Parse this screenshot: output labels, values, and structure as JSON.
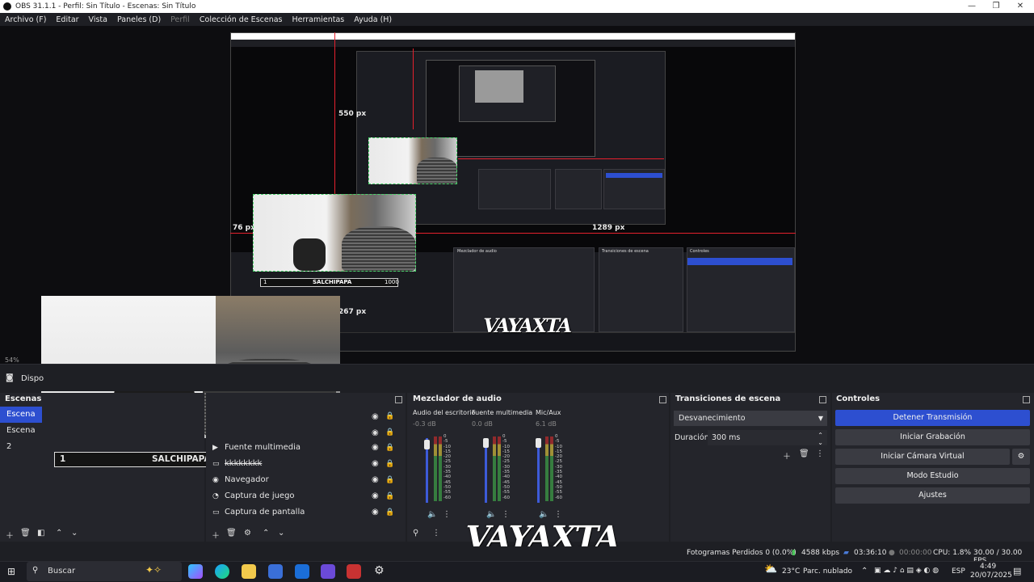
{
  "window": {
    "title": "OBS 31.1.1 - Perfil: Sin Título - Escenas: Sin Título",
    "minimize": "—",
    "maximize": "❐",
    "close": "✕"
  },
  "menu": {
    "items": [
      "Archivo (F)",
      "Editar",
      "Vista",
      "Paneles (D)",
      "Perfil",
      "Colección de Escenas",
      "Herramientas",
      "Ayuda (H)"
    ]
  },
  "preview": {
    "label_550": "550 px",
    "label_76": "76 px",
    "label_1289": "1289 px",
    "label_267": "267 px",
    "zoom": "54%",
    "device_label": "Dispo",
    "overlay_number": "1",
    "overlay_name": "SALCHIPAPA",
    "overlay_value": "1000",
    "graffiti": "VAYAXTA"
  },
  "scenes": {
    "header": "Escenas",
    "items": [
      "Escena",
      "Escena 2"
    ]
  },
  "sources": {
    "items": [
      {
        "icon": "play-icon",
        "label": "Fuente multimedia"
      },
      {
        "icon": "image-icon",
        "label": "kkkkkkkk"
      },
      {
        "icon": "globe-icon",
        "label": "Navegador"
      },
      {
        "icon": "gamepad-icon",
        "label": "Captura de juego"
      },
      {
        "icon": "monitor-icon",
        "label": "Captura de pantalla"
      }
    ]
  },
  "mixer": {
    "header": "Mezclador de audio",
    "channels": [
      {
        "name": "Audio del escritorio",
        "db": "-0.3 dB",
        "level": 0.9
      },
      {
        "name": "Fuente multimedia",
        "db": "0.0 dB",
        "level": 0.93
      },
      {
        "name": "Mic/Aux",
        "db": "6.1 dB",
        "level": 0.93
      }
    ],
    "scale": [
      "0",
      "-5",
      "-10",
      "-15",
      "-20",
      "-25",
      "-30",
      "-35",
      "-40",
      "-45",
      "-50",
      "-55",
      "-60"
    ]
  },
  "transitions": {
    "header": "Transiciones de escena",
    "selected": "Desvanecimiento",
    "duration_label": "Duración",
    "duration_value": "300 ms"
  },
  "controls": {
    "header": "Controles",
    "stop_stream": "Detener Transmisión",
    "start_recording": "Iniciar Grabación",
    "start_virtual_cam": "Iniciar Cámara Virtual",
    "studio_mode": "Modo Estudio",
    "settings": "Ajustes"
  },
  "status": {
    "dropped": "Fotogramas Perdidos 0 (0.0%)",
    "bitrate": "4588 kbps",
    "stream_time": "03:36:10",
    "rec_time": "00:00:00",
    "cpu": "CPU: 1.8%",
    "fps": "30.00 / 30.00 FPS"
  },
  "taskbar": {
    "search_placeholder": "Buscar",
    "weather_temp": "23°C",
    "weather_desc": "Parc. nublado",
    "lang": "ESP",
    "time": "4:49",
    "date": "20/07/2025"
  },
  "colors": {
    "accent": "#2d4fd0",
    "panel": "#24252b",
    "background": "#1e1f24",
    "guide_red": "#e5202d",
    "guide_green": "#49d26a"
  }
}
